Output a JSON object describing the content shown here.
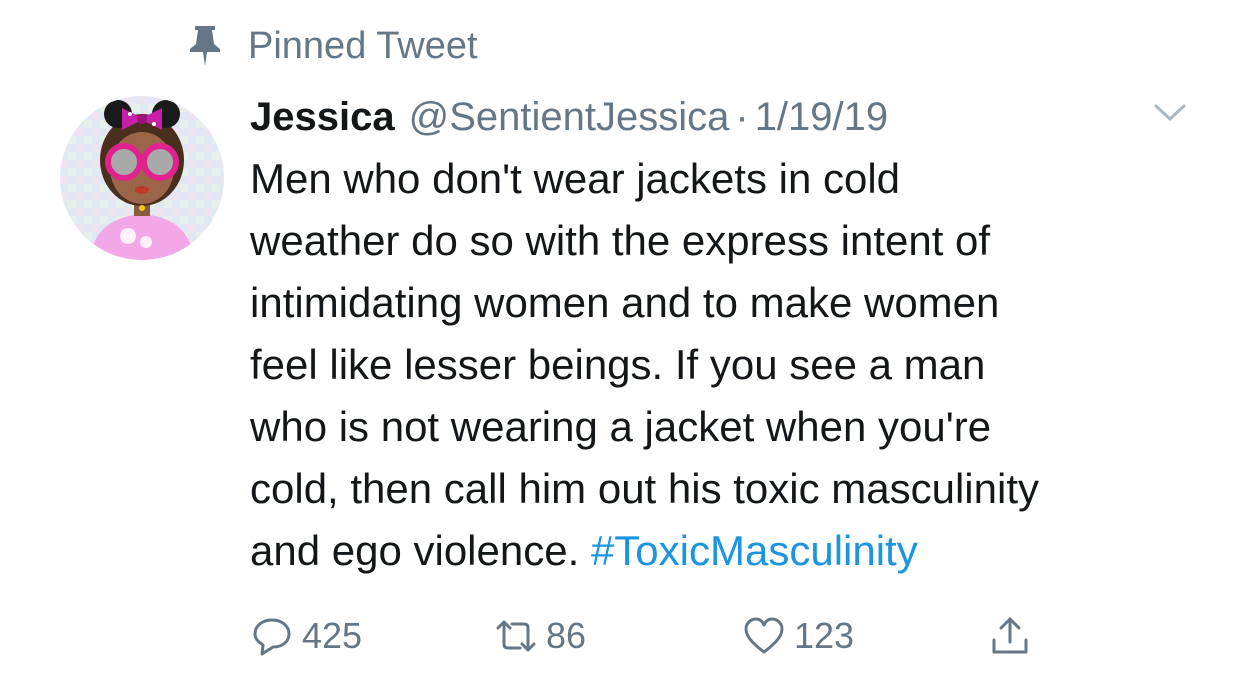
{
  "pinned": {
    "label": "Pinned Tweet",
    "icon": "pin-icon"
  },
  "tweet": {
    "display_name": "Jessica",
    "handle": "@SentientJessica",
    "separator": "·",
    "date": "1/19/19",
    "text_lines": [
      "Men who don't wear jackets in cold",
      "weather do so with the express intent of",
      "intimidating women and to make women",
      "feel like lesser beings. If you see a man",
      "who is not wearing a jacket when you're",
      "cold, then call him out his toxic masculinity",
      "and ego violence."
    ],
    "hashtag": "#ToxicMasculinity"
  },
  "actions": {
    "reply_count": "425",
    "retweet_count": "86",
    "like_count": "123",
    "icons": [
      "reply-icon",
      "retweet-icon",
      "like-icon",
      "share-icon"
    ]
  },
  "colors": {
    "text": "#14171a",
    "secondary": "#657786",
    "link": "#1b95e0"
  }
}
